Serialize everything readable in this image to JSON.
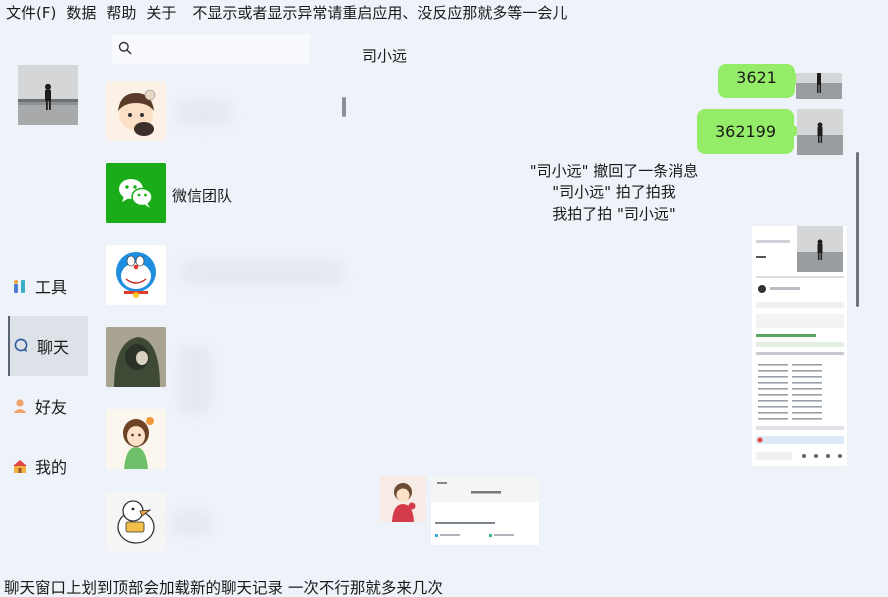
{
  "menu": {
    "items": [
      {
        "label": "文件(F)"
      },
      {
        "label": "数据"
      },
      {
        "label": "帮助"
      },
      {
        "label": "关于"
      }
    ],
    "note": "不显示或者显示异常请重启应用、没反应那就多等一会儿"
  },
  "nav": {
    "items": [
      {
        "label": "工具",
        "icon": "tools-icon"
      },
      {
        "label": "聊天",
        "icon": "chat-icon",
        "active": true
      },
      {
        "label": "好友",
        "icon": "person-icon"
      },
      {
        "label": "我的",
        "icon": "home-icon"
      }
    ]
  },
  "search": {
    "placeholder": "",
    "value": ""
  },
  "contacts": [
    {
      "name": "",
      "avatar": "sticker-boy-avatar"
    },
    {
      "name": "微信团队",
      "avatar": "wechat-logo-avatar"
    },
    {
      "name": "",
      "avatar": "doraemon-avatar"
    },
    {
      "name": "",
      "avatar": "hooded-figure-avatar"
    },
    {
      "name": "",
      "avatar": "sticker-girl-avatar"
    },
    {
      "name": "",
      "avatar": "duck-avatar"
    }
  ],
  "chat": {
    "title": "司小远",
    "messages": [
      {
        "type": "text",
        "text": "3621"
      },
      {
        "type": "text",
        "text": "362199"
      }
    ],
    "system": [
      "\"司小远\" 撤回了一条消息",
      "\"司小远\" 拍了拍我",
      "我拍了拍 \"司小远\""
    ]
  },
  "footer": {
    "hint": "聊天窗口上划到顶部会加载新的聊天记录 一次不行那就多来几次"
  },
  "colors": {
    "background": "#eef2f9",
    "bubble": "#95ec69",
    "wechat_green": "#1aad19"
  }
}
